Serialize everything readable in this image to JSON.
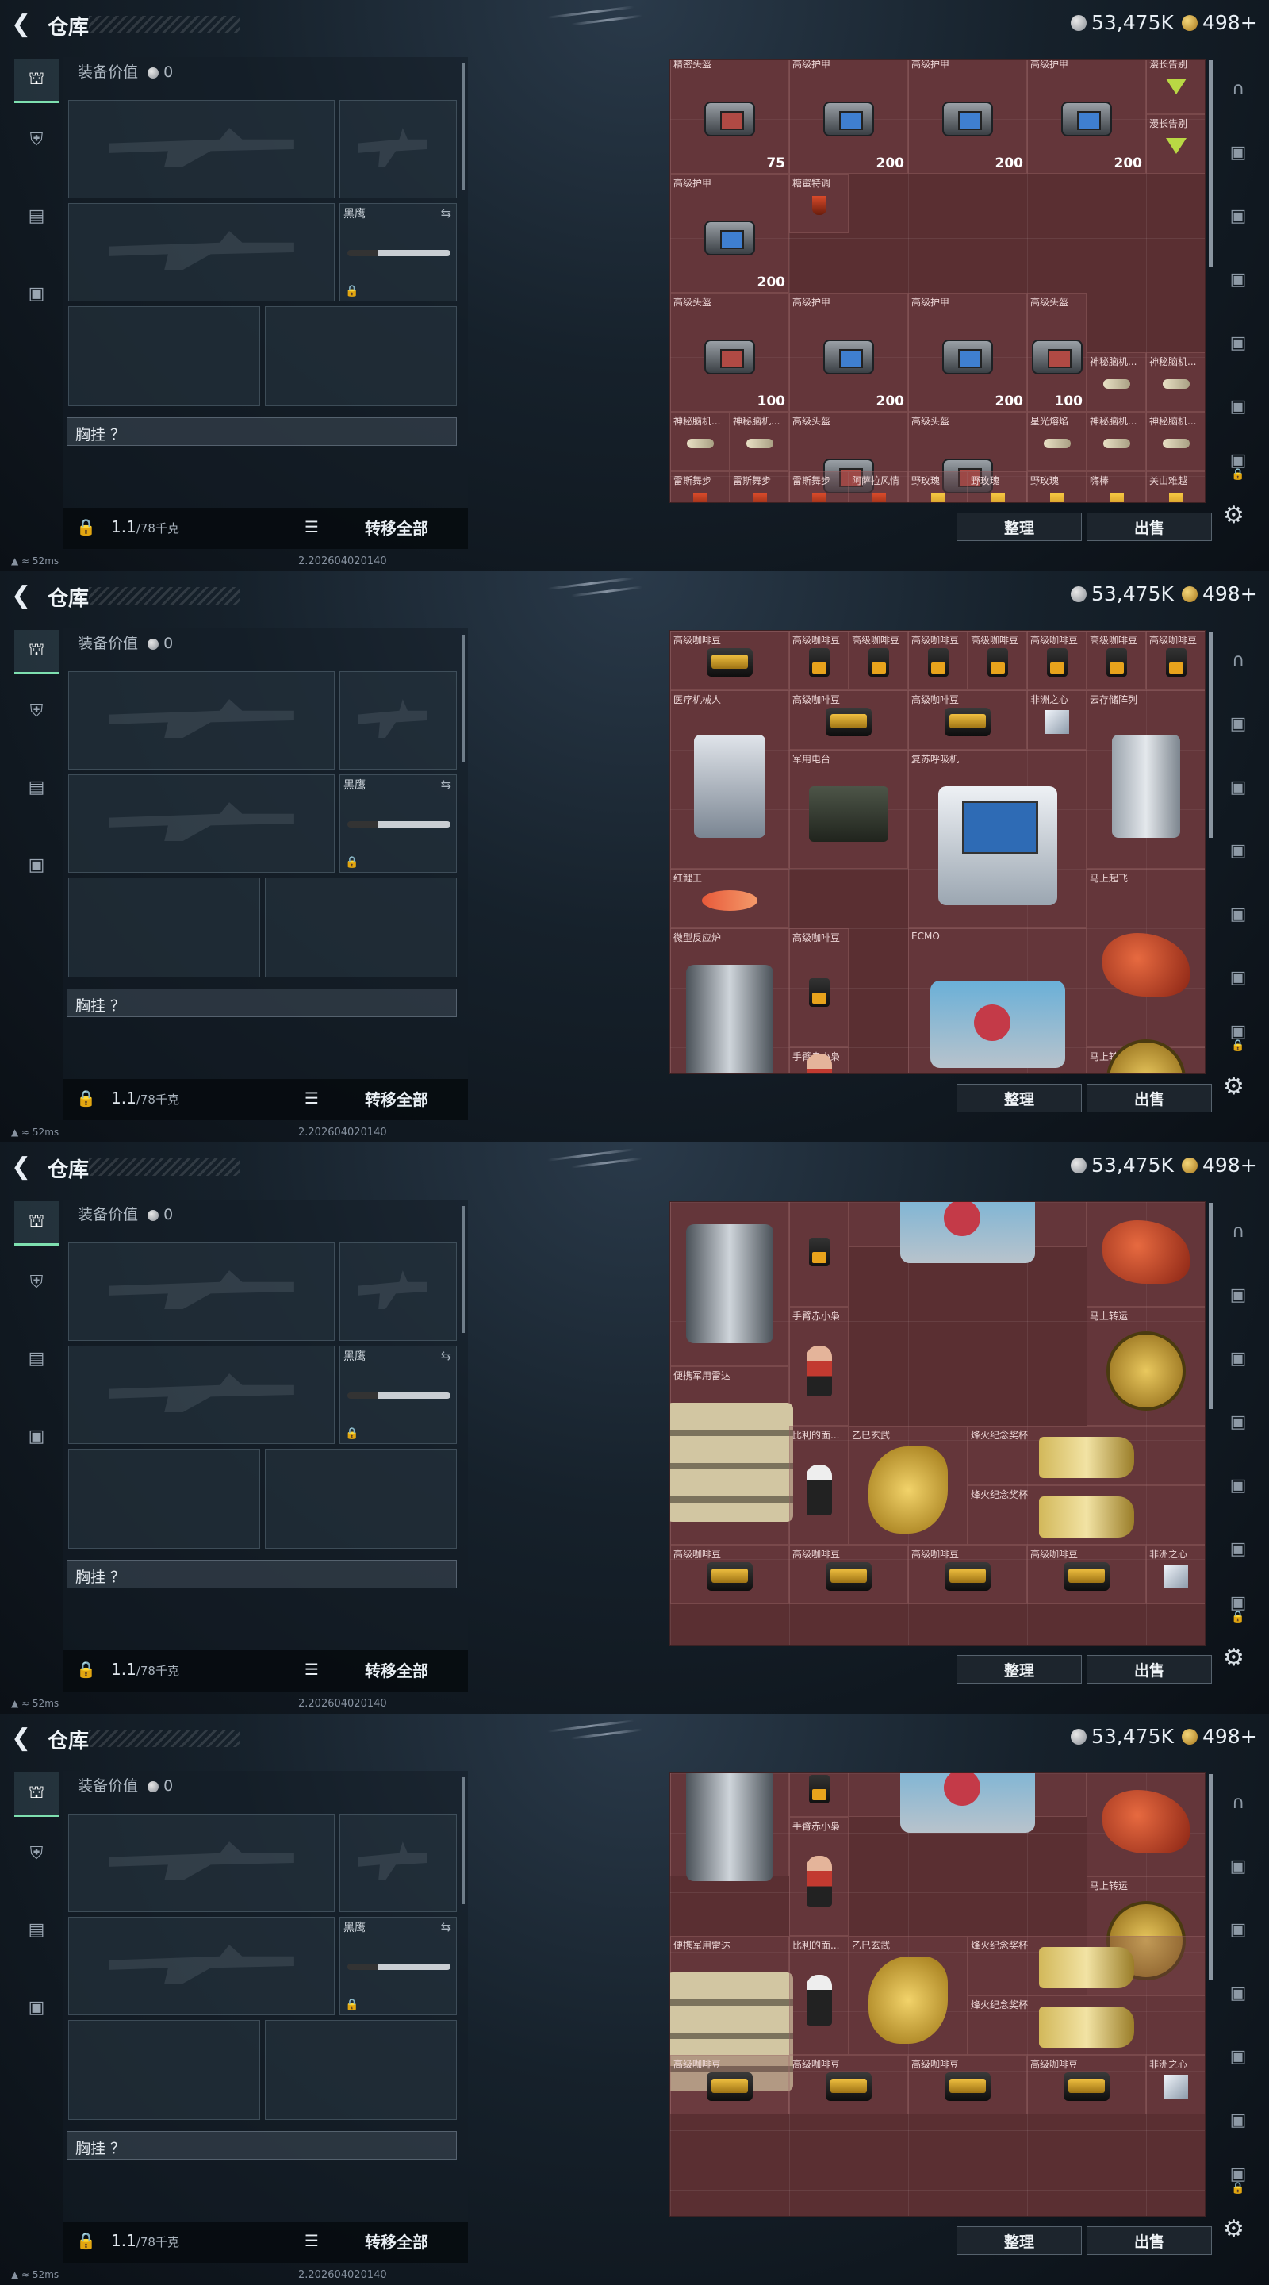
{
  "header": {
    "title": "仓库",
    "silver": "53,475K",
    "gold": "498+"
  },
  "loadout": {
    "value_label": "装备价值",
    "value": "0",
    "knife_label": "黑鹰",
    "chest_label": "胸挂 ？",
    "weight": "1.1",
    "weight_max": "/78千克",
    "transfer_all": "转移全部"
  },
  "status": {
    "ping": "52ms",
    "build": "2.202604020140"
  },
  "buttons": {
    "sort": "整理",
    "sell": "出售"
  },
  "icons": {
    "back": "chevron-left-icon",
    "gear": "gear-icon",
    "lock": "lock-icon",
    "list": "list-icon"
  },
  "colors": {
    "grid_bg": "#5a2f32",
    "accent_tab": "#7ee0b0"
  },
  "panels": [
    {
      "items": [
        {
          "name": "精密头盔",
          "value": "75",
          "shape": "box red"
        },
        {
          "name": "高级护甲",
          "value": "200",
          "shape": "box"
        },
        {
          "name": "高级护甲",
          "value": "200",
          "shape": "box"
        },
        {
          "name": "高级护甲",
          "value": "200",
          "shape": "box"
        },
        {
          "name": "高级护甲",
          "value": "200",
          "shape": "box"
        },
        {
          "name": "糖蜜特调",
          "value": "",
          "shape": "glass red"
        },
        {
          "name": "高级护甲",
          "value": "200",
          "shape": "box"
        },
        {
          "name": "高级护甲",
          "value": "200",
          "shape": "box"
        },
        {
          "name": "高级头盔",
          "value": "100",
          "shape": "box red"
        },
        {
          "name": "漫长告别",
          "value": "",
          "shape": "cocktail"
        },
        {
          "name": "漫长告别",
          "value": "",
          "shape": "cocktail"
        },
        {
          "name": "高级头盔",
          "value": "100",
          "shape": "box red"
        },
        {
          "name": "高级头盔",
          "value": "100",
          "shape": "box red"
        },
        {
          "name": "高级头盔",
          "value": "100",
          "shape": "box red"
        },
        {
          "name": "星光熔焰",
          "value": "",
          "shape": "syringe"
        },
        {
          "name": "神秘脑机...",
          "value": "",
          "shape": "syringe"
        },
        {
          "name": "神秘脑机...",
          "value": "",
          "shape": "syringe"
        },
        {
          "name": "神秘脑机...",
          "value": "",
          "shape": "syringe"
        },
        {
          "name": "神秘脑机...",
          "value": "",
          "shape": "syringe"
        },
        {
          "name": "神秘脑机...",
          "value": "",
          "shape": "syringe"
        },
        {
          "name": "神秘脑机...",
          "value": "",
          "shape": "syringe"
        },
        {
          "name": "雷斯舞步",
          "value": "",
          "shape": "glass red"
        },
        {
          "name": "雷斯舞步",
          "value": "",
          "shape": "glass red"
        },
        {
          "name": "雷斯舞步",
          "value": "",
          "shape": "glass red"
        },
        {
          "name": "阿萨拉风情",
          "value": "",
          "shape": "glass red"
        },
        {
          "name": "野玫瑰",
          "value": "",
          "shape": "glass"
        },
        {
          "name": "野玫瑰",
          "value": "",
          "shape": "glass"
        },
        {
          "name": "野玫瑰",
          "value": "",
          "shape": "glass"
        },
        {
          "name": "嗨棒",
          "value": "",
          "shape": "glass"
        },
        {
          "name": "关山难越",
          "value": "",
          "shape": "glass"
        }
      ]
    },
    {
      "items": [
        {
          "name": "高级咖啡豆",
          "shape": "case"
        },
        {
          "name": "高级咖啡豆",
          "shape": "bag"
        },
        {
          "name": "高级咖啡豆",
          "shape": "bag"
        },
        {
          "name": "高级咖啡豆",
          "shape": "bag"
        },
        {
          "name": "高级咖啡豆",
          "shape": "bag"
        },
        {
          "name": "高级咖啡豆",
          "shape": "bag"
        },
        {
          "name": "高级咖啡豆",
          "shape": "bag"
        },
        {
          "name": "高级咖啡豆",
          "shape": "bag"
        },
        {
          "name": "医疗机械人",
          "shape": "robot"
        },
        {
          "name": "高级咖啡豆",
          "shape": "case"
        },
        {
          "name": "高级咖啡豆",
          "shape": "case"
        },
        {
          "name": "非洲之心",
          "shape": "diamond"
        },
        {
          "name": "云存储阵列",
          "shape": "server"
        },
        {
          "name": "军用电台",
          "shape": "radio"
        },
        {
          "name": "复苏呼吸机",
          "shape": "monitor"
        },
        {
          "name": "红鲤王",
          "shape": "fish"
        },
        {
          "name": "微型反应炉",
          "shape": "reactor"
        },
        {
          "name": "高级咖啡豆",
          "shape": "bag"
        },
        {
          "name": "ECMO",
          "shape": "ecmo"
        },
        {
          "name": "马上起飞",
          "shape": "horse"
        },
        {
          "name": "手臂赤小枭",
          "shape": "doll red"
        },
        {
          "name": "马上转运",
          "shape": "coinbig"
        }
      ]
    },
    {
      "items": [
        {
          "name": "微型反应炉",
          "shape": "reactor"
        },
        {
          "name": "高级咖啡豆",
          "shape": "bag"
        },
        {
          "name": "ECMO",
          "shape": "ecmo"
        },
        {
          "name": "马上起飞",
          "shape": "horse"
        },
        {
          "name": "手臂赤小枭",
          "shape": "doll red"
        },
        {
          "name": "马上转运",
          "shape": "coinbig"
        },
        {
          "name": "便携军用雷达",
          "shape": "crate"
        },
        {
          "name": "比利的面...",
          "shape": "doll"
        },
        {
          "name": "乙巳玄武",
          "shape": "dragon"
        },
        {
          "name": "烽火纪念奖杯",
          "shape": "trophy"
        },
        {
          "name": "烽火纪念奖杯",
          "shape": "trophy"
        },
        {
          "name": "高级咖啡豆",
          "shape": "case"
        },
        {
          "name": "高级咖啡豆",
          "shape": "case"
        },
        {
          "name": "高级咖啡豆",
          "shape": "case"
        },
        {
          "name": "高级咖啡豆",
          "shape": "case"
        },
        {
          "name": "非洲之心",
          "shape": "diamond"
        }
      ]
    },
    {
      "items": [
        {
          "name": "",
          "shape": "reactor"
        },
        {
          "name": "",
          "shape": "bag"
        },
        {
          "name": "ECMO",
          "shape": "ecmo"
        },
        {
          "name": "",
          "shape": "horse"
        },
        {
          "name": "手臂赤小枭",
          "shape": "doll red"
        },
        {
          "name": "马上转运",
          "shape": "coinbig"
        },
        {
          "name": "便携军用雷达",
          "shape": "crate"
        },
        {
          "name": "比利的面...",
          "shape": "doll"
        },
        {
          "name": "乙巳玄武",
          "shape": "dragon"
        },
        {
          "name": "烽火纪念奖杯",
          "shape": "trophy"
        },
        {
          "name": "烽火纪念奖杯",
          "shape": "trophy"
        },
        {
          "name": "高级咖啡豆",
          "shape": "case"
        },
        {
          "name": "高级咖啡豆",
          "shape": "case"
        },
        {
          "name": "高级咖啡豆",
          "shape": "case"
        },
        {
          "name": "高级咖啡豆",
          "shape": "case"
        },
        {
          "name": "非洲之心",
          "shape": "diamond"
        }
      ]
    }
  ]
}
